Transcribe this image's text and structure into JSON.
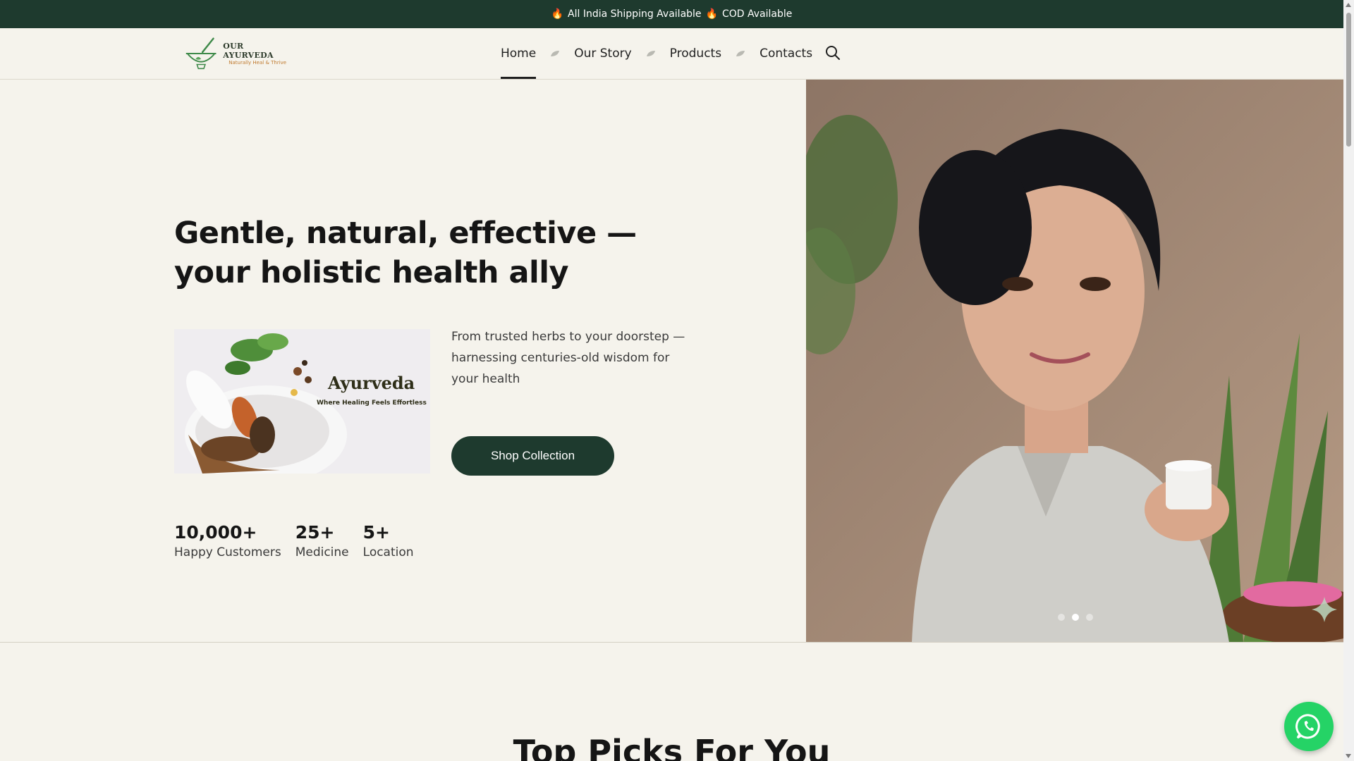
{
  "announcement": {
    "icon": "fire-icon",
    "items": [
      "All India Shipping Available",
      "COD Available"
    ]
  },
  "logo": {
    "name": "OUR AYURVEDA",
    "tagline": "Naturally Heal & Thrive"
  },
  "nav": {
    "items": [
      {
        "label": "Home",
        "active": true
      },
      {
        "label": "Our Story",
        "active": false
      },
      {
        "label": "Products",
        "active": false
      },
      {
        "label": "Contacts",
        "active": false
      }
    ],
    "search_icon": "search-icon"
  },
  "hero": {
    "title_line1": "Gentle, natural, effective —",
    "title_line2": "your holistic health ally",
    "promo_title": "Ayurveda",
    "promo_subtitle": "Where Healing Feels Effortless",
    "description": "From trusted herbs to your doorstep — harnessing centuries-old wisdom for your health",
    "cta_label": "Shop Collection",
    "stats": [
      {
        "value": "10,000+",
        "label": "Happy Customers"
      },
      {
        "value": "25+",
        "label": "Medicine"
      },
      {
        "value": "5+",
        "label": "Location"
      }
    ],
    "slider": {
      "count": 3,
      "active_index": 1
    }
  },
  "section": {
    "title": "Top Picks For You"
  },
  "colors": {
    "brand_dark": "#1e3a2e",
    "background": "#f5f3ec",
    "whatsapp": "#25d366"
  }
}
